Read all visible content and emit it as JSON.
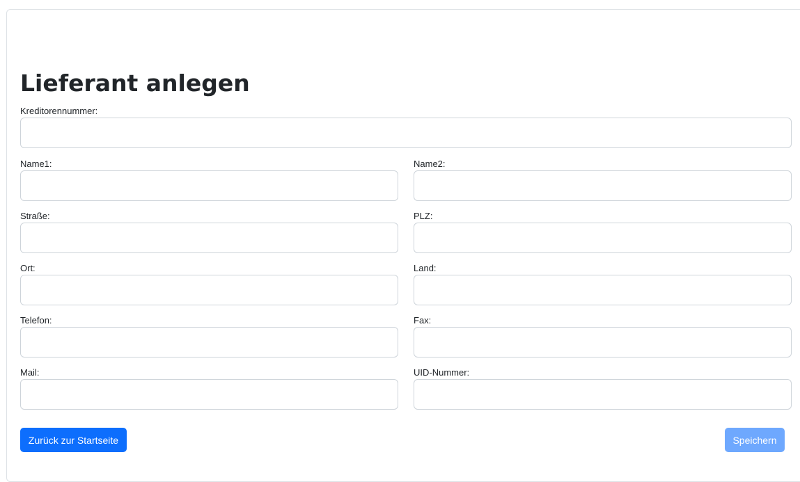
{
  "page": {
    "title": "Lieferant anlegen"
  },
  "form": {
    "kreditorennummer": {
      "label": "Kreditorennummer:",
      "value": ""
    },
    "name1": {
      "label": "Name1:",
      "value": ""
    },
    "name2": {
      "label": "Name2:",
      "value": ""
    },
    "strasse": {
      "label": "Straße:",
      "value": ""
    },
    "plz": {
      "label": "PLZ:",
      "value": ""
    },
    "ort": {
      "label": "Ort:",
      "value": ""
    },
    "land": {
      "label": "Land:",
      "value": ""
    },
    "telefon": {
      "label": "Telefon:",
      "value": ""
    },
    "fax": {
      "label": "Fax:",
      "value": ""
    },
    "mail": {
      "label": "Mail:",
      "value": ""
    },
    "uid": {
      "label": "UID-Nummer:",
      "value": ""
    }
  },
  "actions": {
    "back_label": "Zurück zur Startseite",
    "save_label": "Speichern"
  },
  "colors": {
    "primary": "#0d6efd",
    "primary_disabled": "#6ea8fe",
    "border": "#ced4da",
    "text": "#212529"
  }
}
